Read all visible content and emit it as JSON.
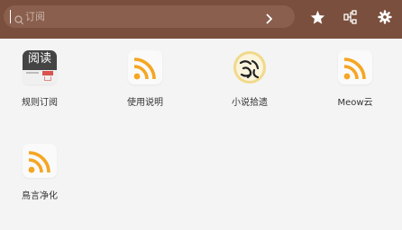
{
  "search": {
    "placeholder": "订阅"
  },
  "toolbar": {
    "icons": [
      "star-icon",
      "group-icon",
      "gear-icon"
    ]
  },
  "items": [
    {
      "label": "规则订阅",
      "icon": "book-app-logo",
      "logo_text": "阅读"
    },
    {
      "label": "使用说明",
      "icon": "rss-icon"
    },
    {
      "label": "小说拾遗",
      "icon": "seal-logo"
    },
    {
      "label": "Meow云",
      "icon": "rss-icon"
    },
    {
      "label": "鳥言净化",
      "icon": "rss-icon"
    }
  ],
  "colors": {
    "topbar": "#7b4f3d",
    "search_bg": "#8a5f4d",
    "rss": "#f5a623",
    "background": "#f4f4f4"
  }
}
